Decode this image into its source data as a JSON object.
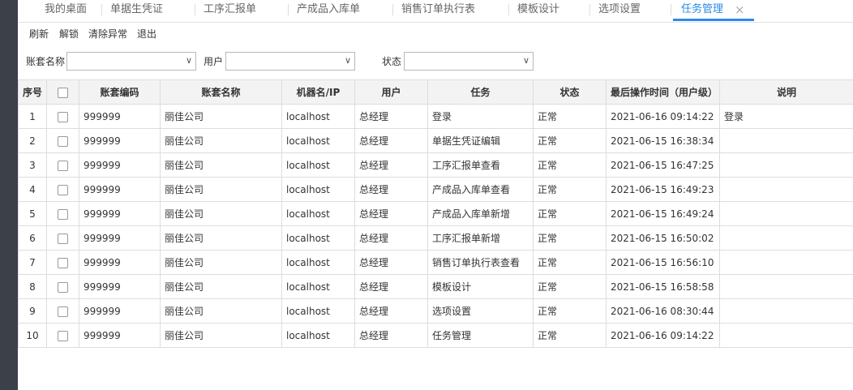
{
  "tabs": [
    {
      "label": "我的桌面"
    },
    {
      "label": "单据生凭证"
    },
    {
      "label": "工序汇报单"
    },
    {
      "label": "产成品入库单"
    },
    {
      "label": "销售订单执行表"
    },
    {
      "label": "模板设计"
    },
    {
      "label": "选项设置"
    },
    {
      "label": "任务管理",
      "active": true
    }
  ],
  "tab_close_icon": "×",
  "toolbar": {
    "refresh": "刷新",
    "unlock": "解锁",
    "clear_error": "清除异常",
    "exit": "退出"
  },
  "filter": {
    "account_name_label": "账套名称",
    "account_name_value": "",
    "user_label": "用户",
    "user_value": "",
    "status_label": "状态",
    "status_value": "",
    "dropdown_icon": "∨"
  },
  "table": {
    "headers": {
      "index": "序号",
      "code": "账套编码",
      "name": "账套名称",
      "machine": "机器名/IP",
      "user": "用户",
      "task": "任务",
      "status": "状态",
      "time": "最后操作时间（用户级）",
      "note": "说明"
    },
    "rows": [
      {
        "index": "1",
        "code": "999999",
        "name": "丽佳公司",
        "machine": "localhost",
        "user": "总经理",
        "task": "登录",
        "status": "正常",
        "time": "2021-06-16 09:14:22",
        "note": "登录"
      },
      {
        "index": "2",
        "code": "999999",
        "name": "丽佳公司",
        "machine": "localhost",
        "user": "总经理",
        "task": "单据生凭证编辑",
        "status": "正常",
        "time": "2021-06-15 16:38:34",
        "note": ""
      },
      {
        "index": "3",
        "code": "999999",
        "name": "丽佳公司",
        "machine": "localhost",
        "user": "总经理",
        "task": "工序汇报单查看",
        "status": "正常",
        "time": "2021-06-15 16:47:25",
        "note": ""
      },
      {
        "index": "4",
        "code": "999999",
        "name": "丽佳公司",
        "machine": "localhost",
        "user": "总经理",
        "task": "产成品入库单查看",
        "status": "正常",
        "time": "2021-06-15 16:49:23",
        "note": ""
      },
      {
        "index": "5",
        "code": "999999",
        "name": "丽佳公司",
        "machine": "localhost",
        "user": "总经理",
        "task": "产成品入库单新增",
        "status": "正常",
        "time": "2021-06-15 16:49:24",
        "note": ""
      },
      {
        "index": "6",
        "code": "999999",
        "name": "丽佳公司",
        "machine": "localhost",
        "user": "总经理",
        "task": "工序汇报单新增",
        "status": "正常",
        "time": "2021-06-15 16:50:02",
        "note": ""
      },
      {
        "index": "7",
        "code": "999999",
        "name": "丽佳公司",
        "machine": "localhost",
        "user": "总经理",
        "task": "销售订单执行表查看",
        "status": "正常",
        "time": "2021-06-15 16:56:10",
        "note": ""
      },
      {
        "index": "8",
        "code": "999999",
        "name": "丽佳公司",
        "machine": "localhost",
        "user": "总经理",
        "task": "模板设计",
        "status": "正常",
        "time": "2021-06-15 16:58:58",
        "note": ""
      },
      {
        "index": "9",
        "code": "999999",
        "name": "丽佳公司",
        "machine": "localhost",
        "user": "总经理",
        "task": "选项设置",
        "status": "正常",
        "time": "2021-06-16 08:30:44",
        "note": ""
      },
      {
        "index": "10",
        "code": "999999",
        "name": "丽佳公司",
        "machine": "localhost",
        "user": "总经理",
        "task": "任务管理",
        "status": "正常",
        "time": "2021-06-16 09:14:22",
        "note": ""
      }
    ]
  },
  "colors": {
    "accent": "#2b8ce6",
    "sidebar": "#3b4049",
    "header_bg": "#f3f3f3"
  }
}
